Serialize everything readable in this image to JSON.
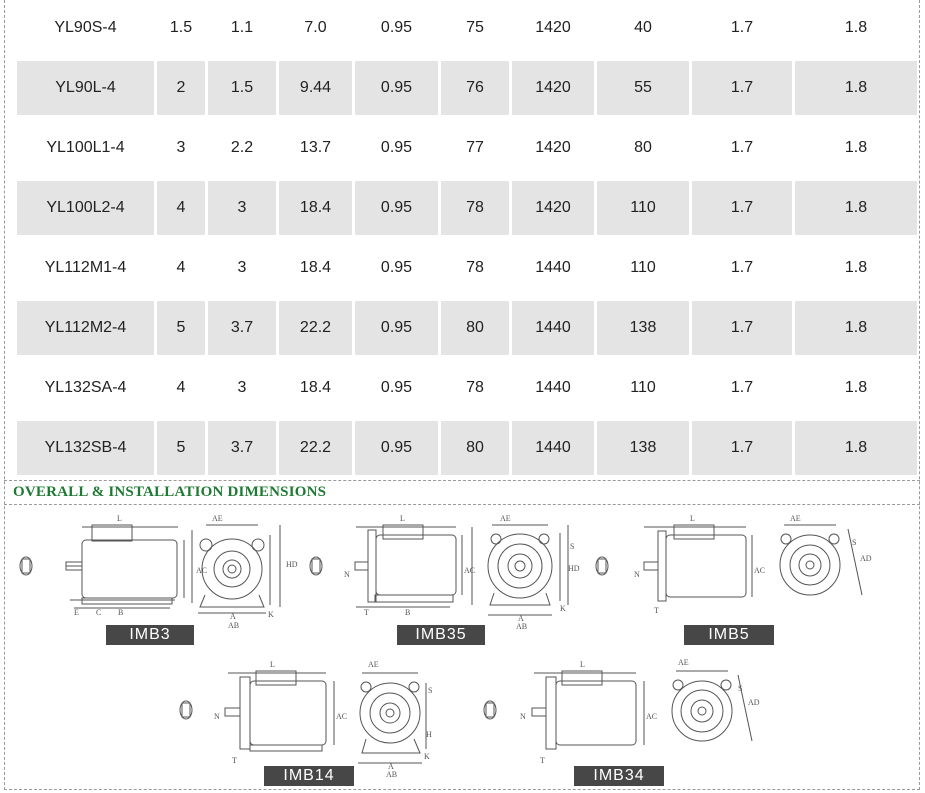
{
  "table": {
    "rows": [
      [
        "YL90S-4",
        "1.5",
        "1.1",
        "7.0",
        "0.95",
        "75",
        "1420",
        "40",
        "1.7",
        "1.8"
      ],
      [
        "YL90L-4",
        "2",
        "1.5",
        "9.44",
        "0.95",
        "76",
        "1420",
        "55",
        "1.7",
        "1.8"
      ],
      [
        "YL100L1-4",
        "3",
        "2.2",
        "13.7",
        "0.95",
        "77",
        "1420",
        "80",
        "1.7",
        "1.8"
      ],
      [
        "YL100L2-4",
        "4",
        "3",
        "18.4",
        "0.95",
        "78",
        "1420",
        "110",
        "1.7",
        "1.8"
      ],
      [
        "YL112M1-4",
        "4",
        "3",
        "18.4",
        "0.95",
        "78",
        "1440",
        "110",
        "1.7",
        "1.8"
      ],
      [
        "YL112M2-4",
        "5",
        "3.7",
        "22.2",
        "0.95",
        "80",
        "1440",
        "138",
        "1.7",
        "1.8"
      ],
      [
        "YL132SA-4",
        "4",
        "3",
        "18.4",
        "0.95",
        "78",
        "1440",
        "110",
        "1.7",
        "1.8"
      ],
      [
        "YL132SB-4",
        "5",
        "3.7",
        "22.2",
        "0.95",
        "80",
        "1440",
        "138",
        "1.7",
        "1.8"
      ]
    ]
  },
  "section": {
    "title": "OVERALL  &  INSTALLATION DIMENSIONS"
  },
  "mountings": [
    {
      "label": "IMB3"
    },
    {
      "label": "IMB35"
    },
    {
      "label": "IMB5"
    },
    {
      "label": "IMB14"
    },
    {
      "label": "IMB34"
    }
  ],
  "dimension_letters": {
    "length": "L",
    "ae": "AE",
    "ac": "AC",
    "hd": "HD",
    "h": "H",
    "a": "A",
    "ab": "AB",
    "b": "B",
    "c": "C",
    "e": "E",
    "k": "K",
    "s": "S",
    "n": "N",
    "t": "T",
    "ad": "AD"
  },
  "colors": {
    "heading": "#1e7a32",
    "row_shade": "#e4e4e4",
    "label_bg": "#474747",
    "drawing_line": "#555555"
  }
}
